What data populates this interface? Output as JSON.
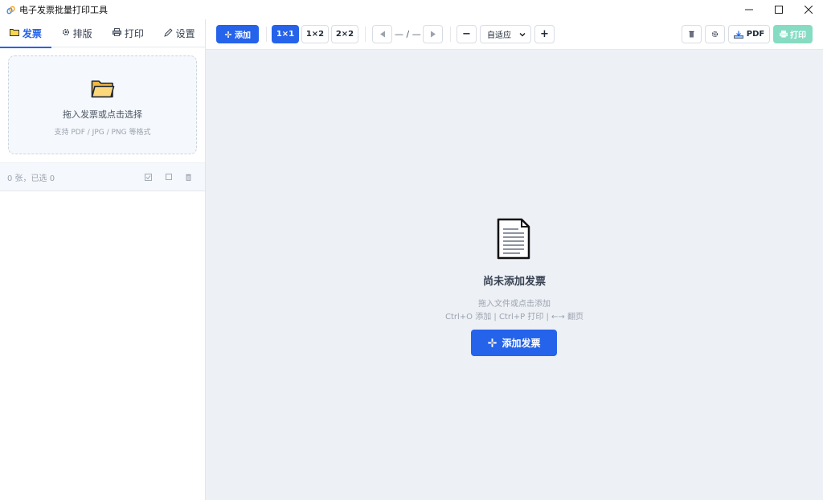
{
  "window": {
    "title": "电子发票批量打印工具",
    "app_icon": "link-icon",
    "controls": [
      "minimize-icon",
      "maximize-icon",
      "close-icon"
    ]
  },
  "sidebar": {
    "tabs": [
      {
        "label": "发票",
        "icon": "folder-icon",
        "active": true
      },
      {
        "label": "排版",
        "icon": "gear-icon",
        "active": false
      },
      {
        "label": "打印",
        "icon": "printer-icon",
        "active": false
      },
      {
        "label": "设置",
        "icon": "pencil-icon",
        "active": false
      }
    ],
    "dropzone": {
      "title": "拖入发票或点击选择",
      "subtitle": "支持 PDF / JPG / PNG 等格式"
    },
    "list": {
      "count_text": "0 张，已选 0",
      "actions": [
        "select-all-icon",
        "deselect-icon",
        "delete-icon"
      ]
    }
  },
  "toolbar": {
    "add_label": "添加",
    "layouts": [
      {
        "label": "1×1",
        "active": true
      },
      {
        "label": "1×2",
        "active": false
      },
      {
        "label": "2×2",
        "active": false
      }
    ],
    "page_indicator": "— / —",
    "zoom_minus": "−",
    "zoom_value": "自适应",
    "zoom_plus": "+",
    "pdf_label": "PDF",
    "print_label": "打印"
  },
  "empty_state": {
    "title": "尚未添加发票",
    "hint_line1": "拖入文件或点击添加",
    "hint_line2": "Ctrl+O 添加 | Ctrl+P 打印 | ←→ 翻页",
    "button_label": "添加发票"
  },
  "colors": {
    "accent": "#2563eb",
    "print_disabled": "#86dcc3",
    "canvas_bg": "#edf0f5"
  }
}
